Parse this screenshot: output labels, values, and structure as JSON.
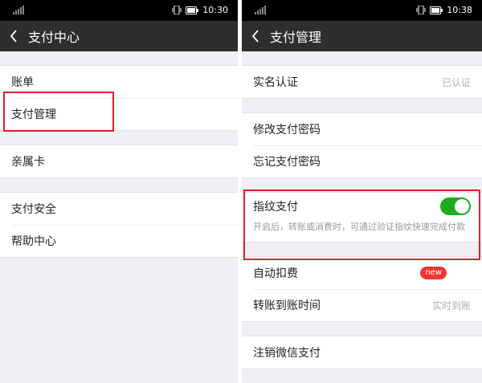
{
  "left": {
    "status": {
      "time": "10:30"
    },
    "title": "支付中心",
    "groups": [
      {
        "items": [
          {
            "label": "账单"
          },
          {
            "label": "支付管理"
          }
        ]
      },
      {
        "items": [
          {
            "label": "亲属卡"
          }
        ]
      },
      {
        "items": [
          {
            "label": "支付安全"
          },
          {
            "label": "帮助中心"
          }
        ]
      }
    ]
  },
  "right": {
    "status": {
      "time": "10:38"
    },
    "title": "支付管理",
    "real_name": {
      "label": "实名认证",
      "value": "已认证"
    },
    "change_password": {
      "label": "修改支付密码"
    },
    "forgot_password": {
      "label": "忘记支付密码"
    },
    "fingerprint": {
      "label": "指纹支付",
      "enabled": true,
      "note": "开启后，转账或消费时，可通过验证指纹快速完成付款"
    },
    "auto_deduct": {
      "label": "自动扣费",
      "badge": "new"
    },
    "transfer_time": {
      "label": "转账到账时间",
      "value": "实时到账"
    },
    "cancel": {
      "label": "注销微信支付"
    }
  },
  "colors": {
    "highlight": "#e0202b",
    "toggle_on": "#1aad19",
    "badge": "#f43530",
    "title_bar": "#2e2e2e"
  }
}
